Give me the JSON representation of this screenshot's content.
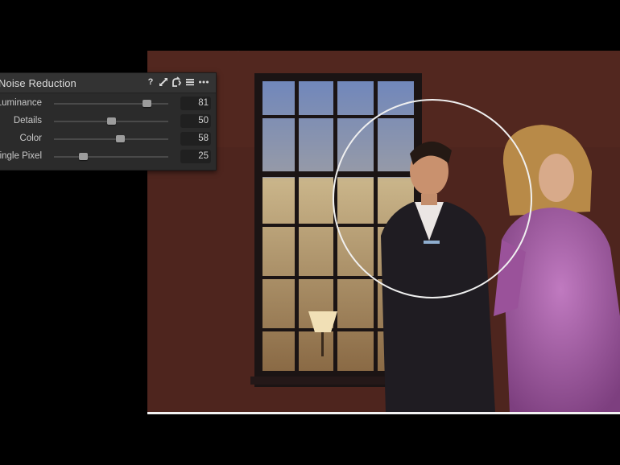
{
  "panel": {
    "title": "Noise Reduction",
    "header_icons": [
      "help-icon",
      "expand-icon",
      "reset-icon",
      "list-icon",
      "more-icon"
    ],
    "help_glyph": "?",
    "sliders": [
      {
        "label": "Luminance",
        "value": "81",
        "level": 81
      },
      {
        "label": "Details",
        "value": "50",
        "level": 50
      },
      {
        "label": "Color",
        "value": "58",
        "level": 58
      },
      {
        "label": "Single Pixel",
        "value": "25",
        "level": 25
      }
    ]
  },
  "photo": {
    "description_icons": [
      "loupe-circle"
    ]
  },
  "colors": {
    "panel_bg": "#2b2b2b",
    "panel_header": "#333333",
    "wall": "#4d241d",
    "dress": "#a65ca3",
    "suit": "#1f1c22"
  }
}
